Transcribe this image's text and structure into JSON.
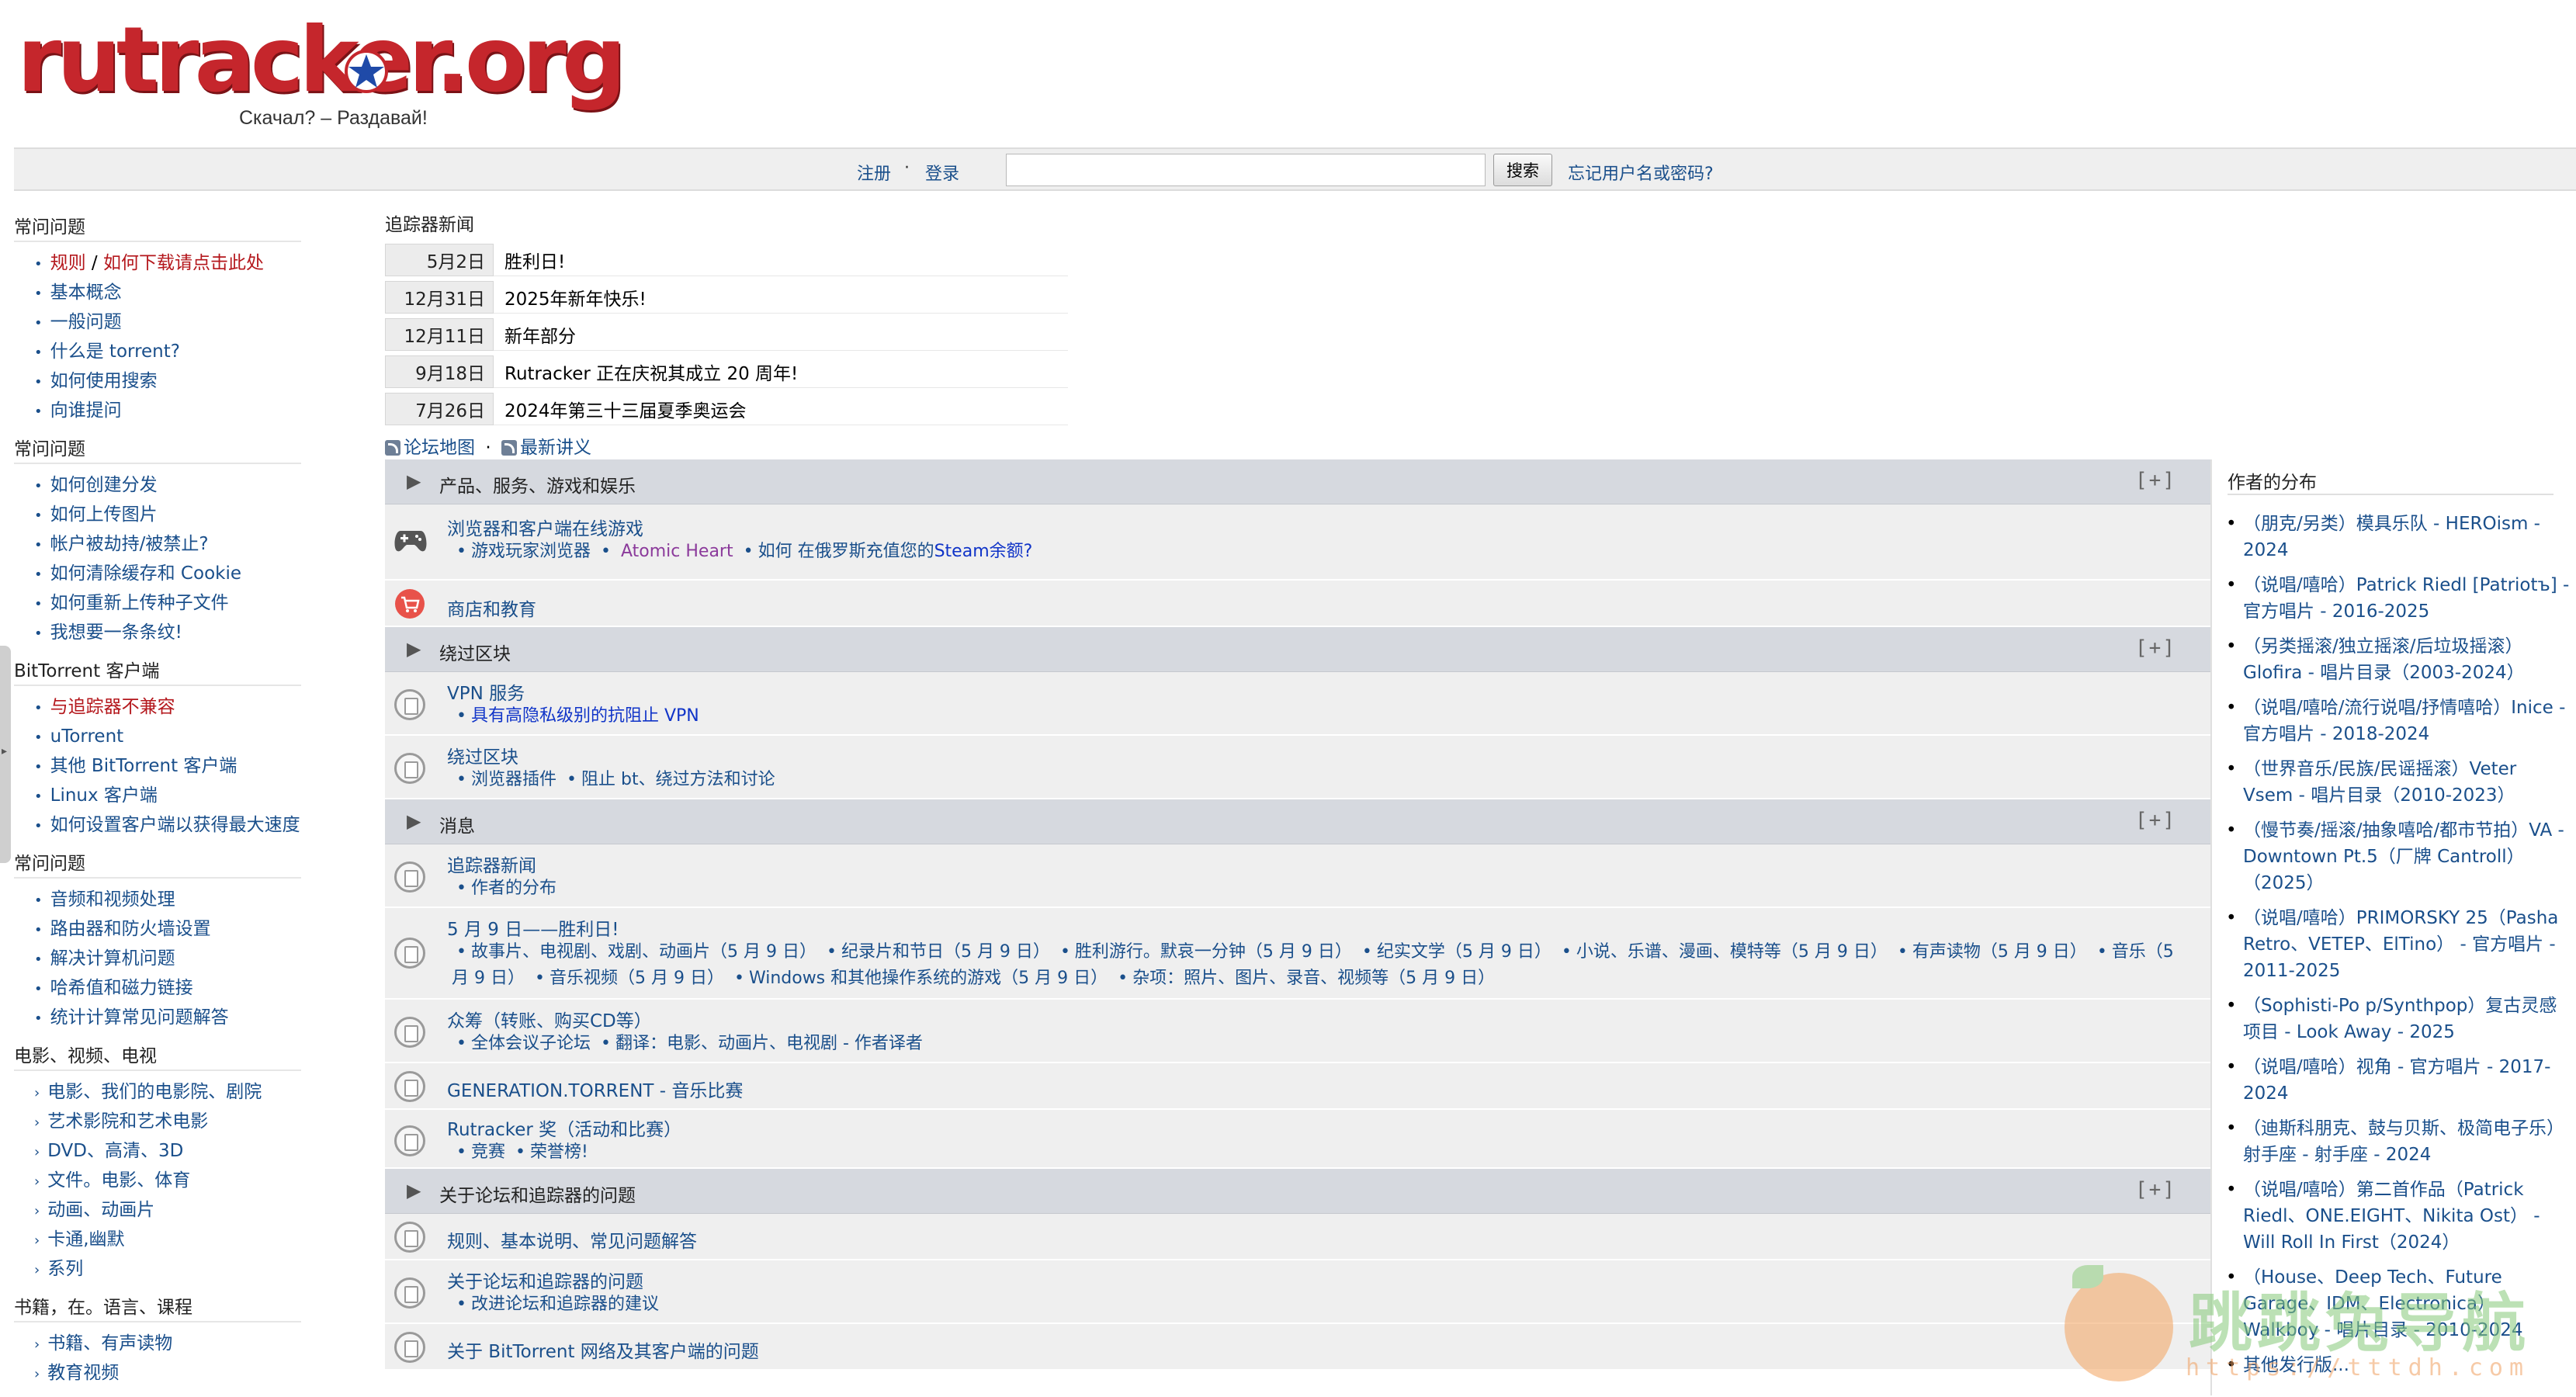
{
  "logo": {
    "text": "rutracker.org",
    "tagline": "Скачал? – Раздавай!"
  },
  "topbar": {
    "register": "注册",
    "separator": "·",
    "login": "登录",
    "search_placeholder": "",
    "search_button": "搜索",
    "forgot": "忘记用户名或密码?"
  },
  "leftnav": {
    "sections": [
      {
        "title": "常问问题",
        "items": [
          {
            "label": "规则",
            "label2": "如何下载请点击此处",
            "red": true
          },
          {
            "label": "基本概念"
          },
          {
            "label": "一般问题"
          },
          {
            "label": "什么是 torrent?"
          },
          {
            "label": "如何使用搜索"
          },
          {
            "label": "向谁提问"
          }
        ]
      },
      {
        "title": "常问问题",
        "items": [
          {
            "label": "如何创建分发"
          },
          {
            "label": "如何上传图片"
          },
          {
            "label": "帐户被劫持/被禁止?"
          },
          {
            "label": "如何清除缓存和 Cookie"
          },
          {
            "label": "如何重新上传种子文件"
          },
          {
            "label": "我想要一条条纹!"
          }
        ]
      },
      {
        "title": "BitTorrent 客户端",
        "items": [
          {
            "label": "与追踪器不兼容",
            "red": true
          },
          {
            "label": "uTorrent"
          },
          {
            "label": "其他 BitTorrent 客户端"
          },
          {
            "label": "Linux 客户端"
          },
          {
            "label": "如何设置客户端以获得最大速度"
          }
        ]
      },
      {
        "title": "常问问题",
        "items": [
          {
            "label": "音频和视频处理"
          },
          {
            "label": "路由器和防火墙设置"
          },
          {
            "label": "解决计算机问题"
          },
          {
            "label": "哈希值和磁力链接"
          },
          {
            "label": "统计计算常见问题解答"
          }
        ]
      },
      {
        "title": "电影、视频、电视",
        "arrow": true,
        "items": [
          {
            "label": "电影、我们的电影院、剧院"
          },
          {
            "label": "艺术影院和艺术电影"
          },
          {
            "label": "DVD、高清、3D"
          },
          {
            "label": "文件。电影、体育"
          },
          {
            "label": "动画、动画片"
          },
          {
            "label": "卡通,幽默"
          },
          {
            "label": "系列"
          }
        ]
      },
      {
        "title": "书籍，在。语言、课程",
        "arrow": true,
        "items": [
          {
            "label": "书籍、有声读物"
          },
          {
            "label": "教育视频"
          }
        ]
      }
    ]
  },
  "news": {
    "title": "追踪器新闻",
    "items": [
      {
        "date": "5月2日",
        "text": "胜利日!"
      },
      {
        "date": "12月31日",
        "text": "2025年新年快乐!"
      },
      {
        "date": "12月11日",
        "text": "新年部分"
      },
      {
        "date": "9月18日",
        "text": "Rutracker 正在庆祝其成立 20 周年!"
      },
      {
        "date": "7月26日",
        "text": "2024年第三十三届夏季奥运会"
      }
    ]
  },
  "maplinks": {
    "sitemap": "论坛地图",
    "sep": "·",
    "latest": "最新讲义"
  },
  "forum": {
    "plus": "[+]",
    "cat1": {
      "name": "产品、服务、游戏和娱乐"
    },
    "f_browser": {
      "title": "浏览器和客户端在线游戏",
      "s1": "游戏玩家浏览器",
      "s2": "Atomic Heart",
      "s3": "如何 在俄罗斯充值您的",
      "s4": "Steam余额?"
    },
    "f_shop": {
      "title": "商店和教育"
    },
    "cat2": {
      "name": "绕过区块"
    },
    "f_vpn": {
      "title": "VPN 服务",
      "s1": "具有高隐私级别的抗阻止 VPN"
    },
    "f_bypass": {
      "title": "绕过区块",
      "s1": "浏览器插件",
      "s2": "阻止 bt、绕过方法和讨论"
    },
    "cat3": {
      "name": "消息"
    },
    "f_news": {
      "title": "追踪器新闻",
      "s1": "作者的分布"
    },
    "f_may9": {
      "title": "5 月 9 日——胜利日!",
      "subs": [
        "故事片、电视剧、戏剧、动画片（5 月 9 日）",
        "纪录片和节日（5 月 9 日）",
        "胜利游行。默哀一分钟（5 月 9 日）",
        "纪实文学（5 月 9 日）",
        "小说、乐谱、漫画、模特等（5 月 9 日）",
        "有声读物（5 月 9 日）",
        "音乐（5 月 9 日）",
        "音乐视频（5 月 9 日）",
        "Windows 和其他操作系统的游戏（5 月 9 日）",
        "杂项：照片、图片、录音、视频等（5 月 9 日）"
      ]
    },
    "f_crowd": {
      "title": "众筹（转账、购买CD等）",
      "s1": "全体会议子论坛",
      "s2": "翻译：电影、动画片、电视剧 - 作者译者"
    },
    "f_gen": {
      "title": "GENERATION.TORRENT - 音乐比赛"
    },
    "f_award": {
      "title": "Rutracker 奖（活动和比赛）",
      "s1": "竞赛",
      "s2": "荣誉榜!"
    },
    "cat4": {
      "name": "关于论坛和追踪器的问题"
    },
    "f_rules": {
      "title": "规则、基本说明、常见问题解答"
    },
    "f_forumq": {
      "title": "关于论坛和追踪器的问题",
      "s1": "改进论坛和追踪器的建议"
    },
    "f_bt": {
      "title": "关于 BitTorrent 网络及其客户端的问题"
    }
  },
  "rightcol": {
    "title": "作者的分布",
    "items": [
      "（朋克/另类）模具乐队 - HEROism - 2024",
      "（说唱/嘻哈）Patrick Riedl [Patriotъ] - 官方唱片 - 2016-2025",
      "（另类摇滚/独立摇滚/后垃圾摇滚）Glofira - 唱片目录（2003-2024）",
      "（说唱/嘻哈/流行说唱/抒情嘻哈）Inice - 官方唱片 - 2018-2024",
      "（世界音乐/民族/民谣摇滚）Veter Vsem - 唱片目录（2010-2023）",
      "（慢节奏/摇滚/抽象嘻哈/都市节拍）VA - Downtown Pt.5（厂牌 Cantroll）（2025）",
      "（说唱/嘻哈）PRIMORSKY 25（Pasha Retro、VETEP、ElTino） - 官方唱片 - 2011-2025",
      "（Sophisti-Po p/Synthpop）复古灵感项目 - Look Away - 2025",
      "（说唱/嘻哈）视角 - 官方唱片 - 2017-2024",
      "（迪斯科朋克、鼓与贝斯、极简电子乐）射手座 - 射手座 - 2024",
      "（说唱/嘻哈）第二首作品（Patrick Riedl、ONE.EIGHT、Nikita Ost） - Will Roll In First（2024）",
      "（House、Deep Tech、Future Garage、IDM、Electronica）Walkboy - 唱片目录 - 2010-2024",
      "其他发行版..."
    ]
  },
  "watermark": {
    "text": "跳跳兔导航",
    "url": "https://tttdh.com"
  }
}
